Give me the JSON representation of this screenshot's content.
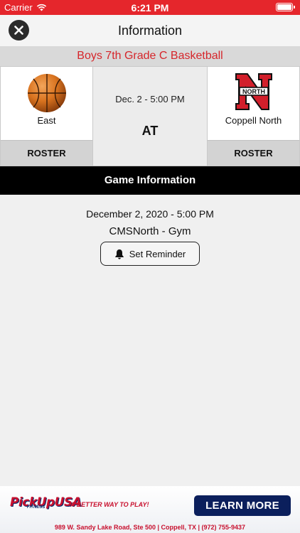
{
  "status_bar": {
    "carrier": "Carrier",
    "time": "6:21 PM",
    "color": "#e5262c"
  },
  "nav": {
    "title": "Information",
    "close_icon": "close-icon"
  },
  "event": {
    "title": "Boys 7th Grade C Basketball",
    "title_color": "#d6262b"
  },
  "matchup": {
    "home": {
      "name": "East",
      "logo_icon": "basketball-icon",
      "roster_label": "ROSTER"
    },
    "away": {
      "name": "Coppell North",
      "logo_icon": "north-n-logo",
      "logo_text": "NORTH",
      "roster_label": "ROSTER"
    },
    "datetime": "Dec. 2 - 5:00 PM",
    "separator": "AT"
  },
  "game_info": {
    "header": "Game Information",
    "date": "December 2, 2020 - 5:00 PM",
    "location": "CMSNorth - Gym",
    "reminder_label": "Set Reminder",
    "reminder_icon": "bell-icon"
  },
  "ad": {
    "brand": "PickUpUSA",
    "brand_sub": "FITNESS",
    "tagline": "A BETTER WAY TO PLAY!",
    "cta": "LEARN MORE",
    "address": "989 W. Sandy Lake Road, Ste 500  |  Coppell, TX  |  (972) 755-9437"
  }
}
